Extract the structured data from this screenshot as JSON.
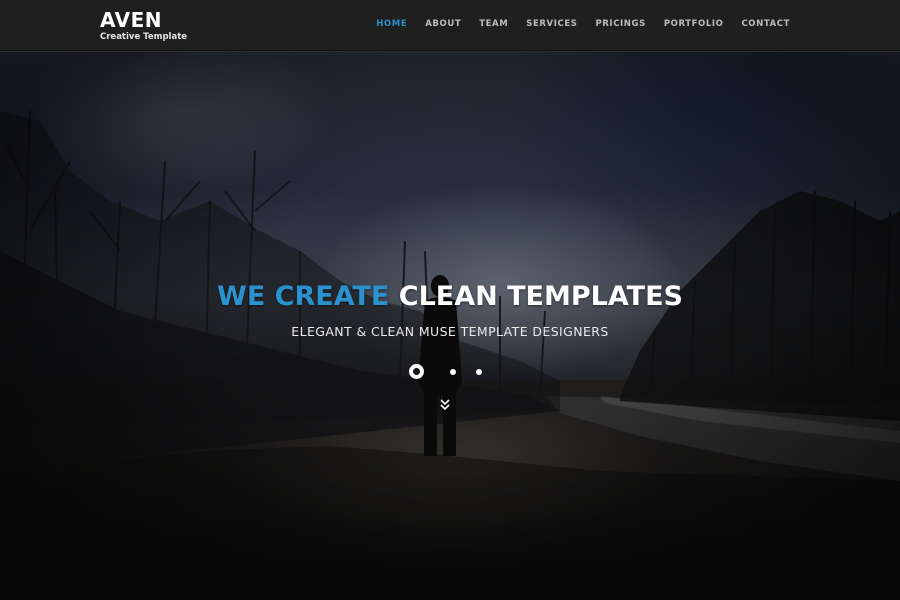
{
  "navbar": {
    "brand_title": "AVEN",
    "brand_subtitle": "Creative Template",
    "items": [
      {
        "label": "HOME",
        "active": true
      },
      {
        "label": "ABOUT",
        "active": false
      },
      {
        "label": "TEAM",
        "active": false
      },
      {
        "label": "SERVICES",
        "active": false
      },
      {
        "label": "PRICINGS",
        "active": false
      },
      {
        "label": "PORTFOLIO",
        "active": false
      },
      {
        "label": "CONTACT",
        "active": false
      }
    ]
  },
  "hero": {
    "title_accent": "WE CREATE",
    "title_main": "CLEAN TEMPLATES",
    "subtitle": "ELEGANT & CLEAN MUSE TEMPLATE DESIGNERS",
    "slider": {
      "total": 3,
      "active_index": 1
    },
    "scroll_icon": "double-chevron-down-icon"
  },
  "colors": {
    "accent": "#2a93cf",
    "nav_bg": "#1f1f1f",
    "nav_text": "#bdbdbd",
    "nav_active": "#2a8ec3"
  }
}
